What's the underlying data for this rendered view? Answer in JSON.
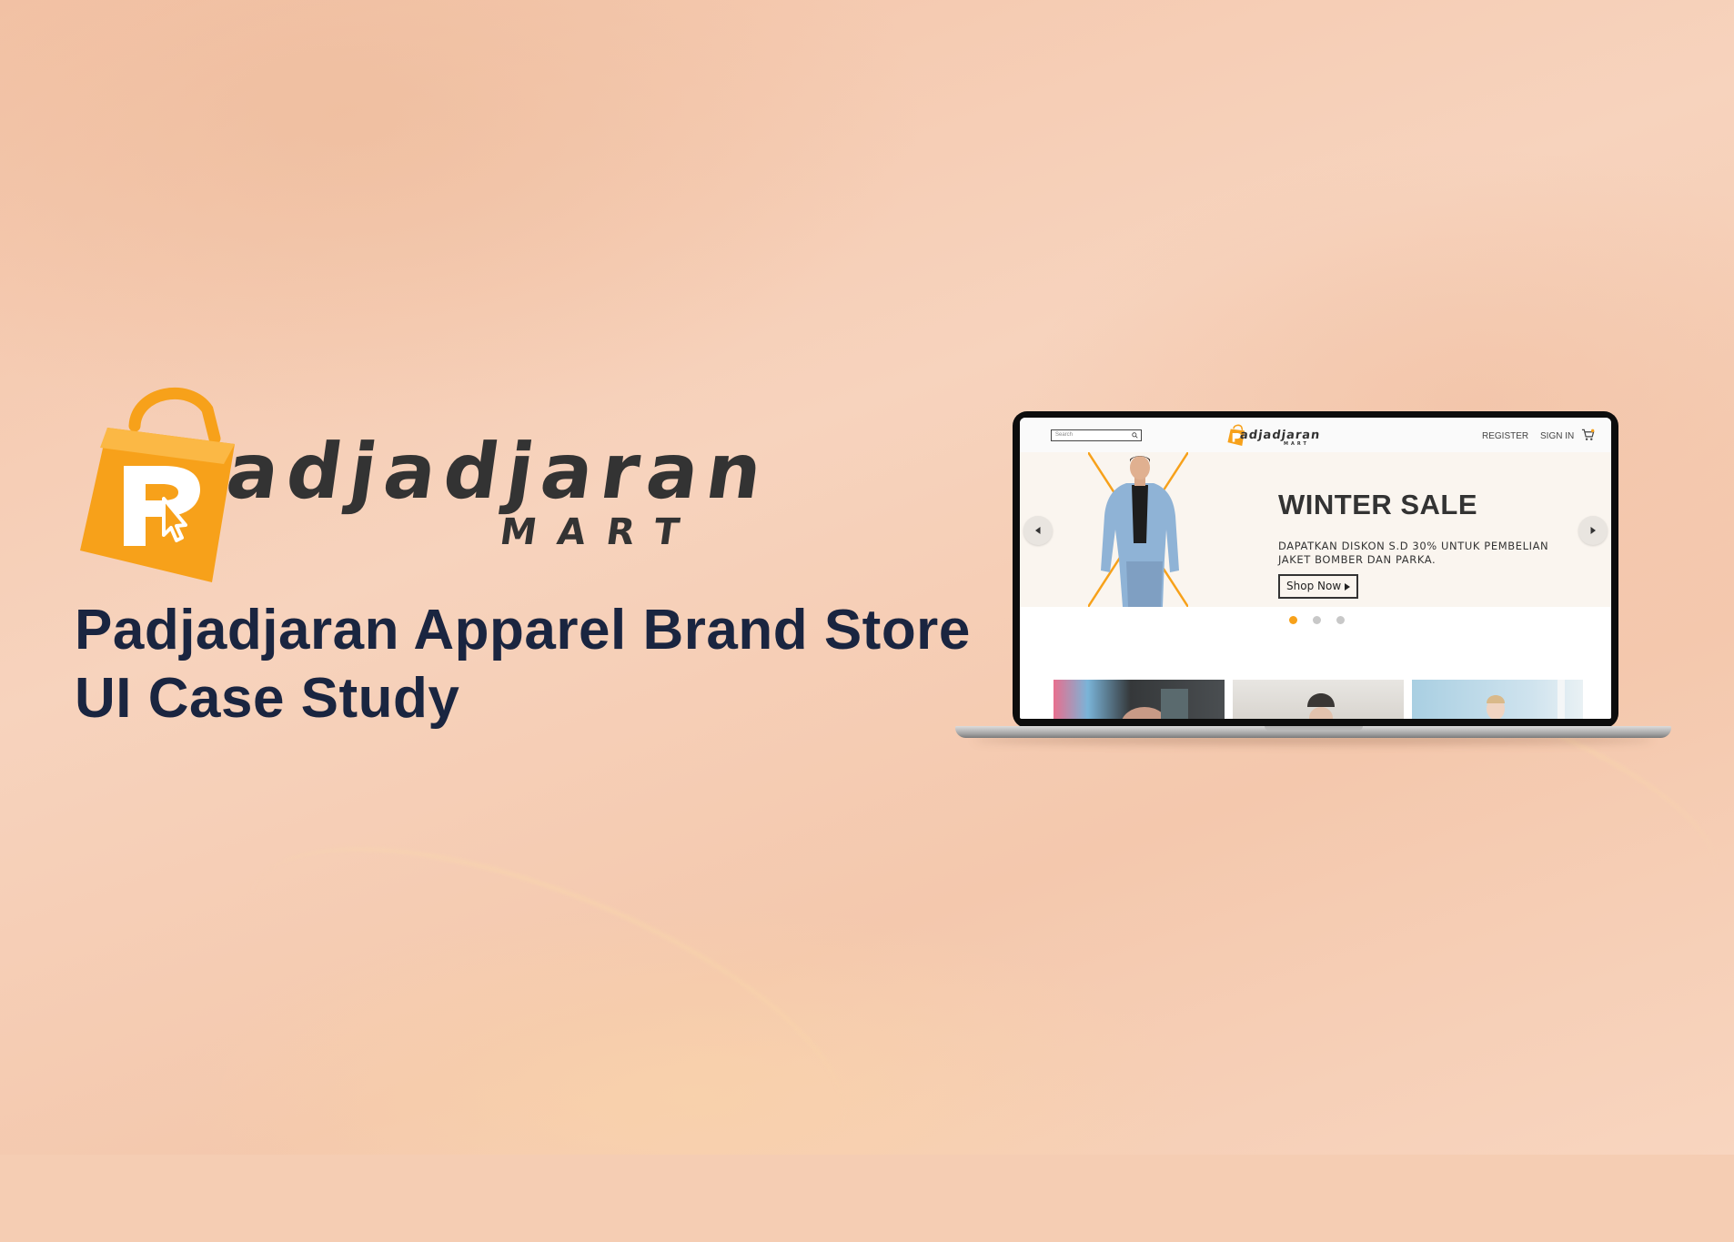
{
  "brand": {
    "wordmark": "adjadjaran",
    "wordmark_sub": "MART",
    "accent_color": "#f7a11a",
    "text_color": "#333333"
  },
  "title": {
    "line1": "Padjadjaran Apparel Brand Store",
    "line2": "UI Case Study",
    "color": "#1a2540"
  },
  "mockup": {
    "nav": {
      "search_placeholder": "Search",
      "logo_word": "adjadjaran",
      "logo_sub": "MART",
      "register": "REGISTER",
      "sign_in": "SIGN IN",
      "cart_icon": "cart-icon"
    },
    "hero": {
      "title": "WINTER SALE",
      "subtitle_line1": "DAPATKAN DISKON S.D 30% UNTUK PEMBELIAN",
      "subtitle_line2": "JAKET BOMBER DAN PARKA.",
      "cta": "Shop Now",
      "prev_icon": "chevron-left-icon",
      "next_icon": "chevron-right-icon"
    },
    "carousel": {
      "slide_count": 3,
      "active_slide": 1
    }
  }
}
